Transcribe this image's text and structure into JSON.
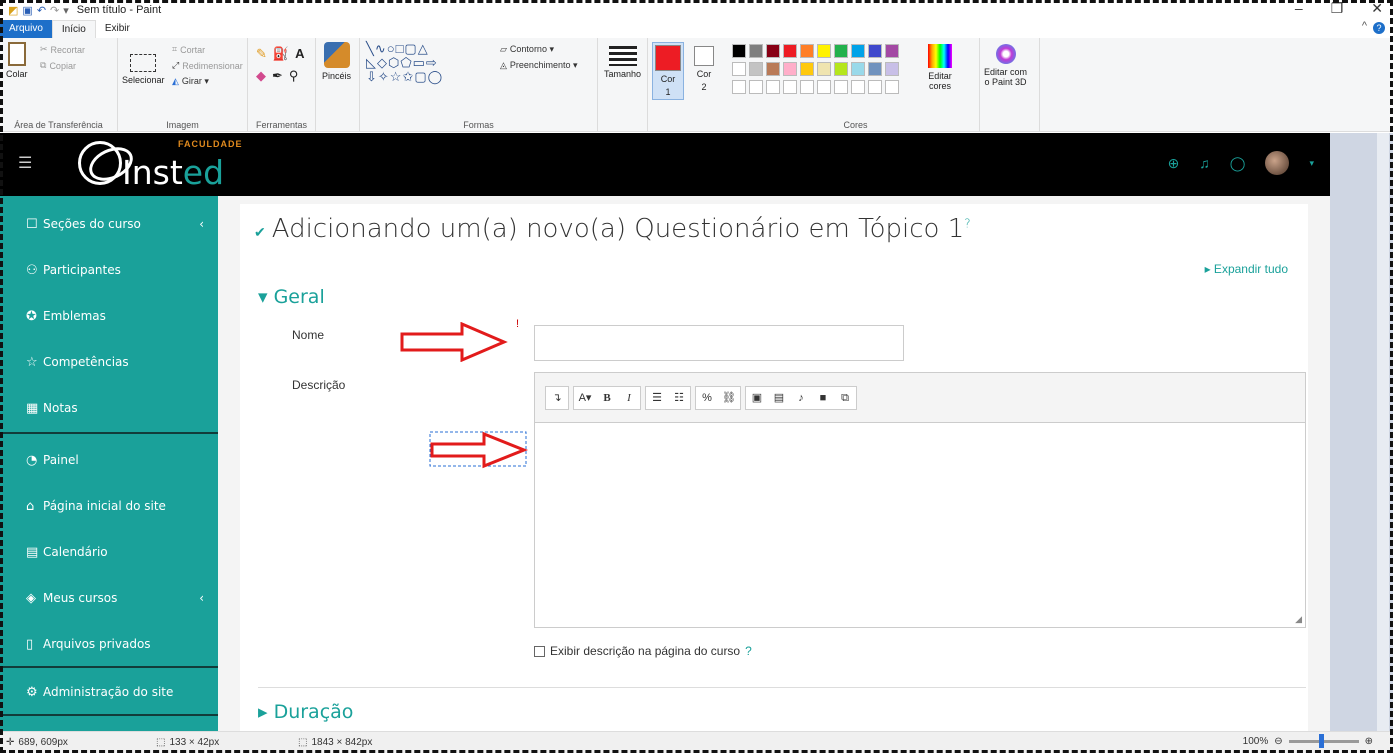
{
  "window": {
    "title": "Sem título - Paint",
    "minimize": "–",
    "maximize": "❐",
    "close": "✕"
  },
  "ribbon_tabs": [
    "Arquivo",
    "Início",
    "Exibir"
  ],
  "ribbon": {
    "clipboard": {
      "paste": "Colar",
      "cut": "Recortar",
      "copy": "Copiar",
      "label": "Área de Transferência"
    },
    "image": {
      "select": "Selecionar",
      "crop": "Cortar",
      "resize": "Redimensionar",
      "rotate": "Girar ▾",
      "label": "Imagem"
    },
    "tools": {
      "label": "Ferramentas"
    },
    "brushes": {
      "label": "Pincéis"
    },
    "shapes": {
      "outline": "Contorno ▾",
      "fill": "Preenchimento ▾",
      "label": "Formas"
    },
    "size": {
      "label": "Tamanho"
    },
    "color1": {
      "label1": "Cor",
      "label2": "1"
    },
    "color2": {
      "label1": "Cor",
      "label2": "2"
    },
    "colors": {
      "label": "Cores",
      "edit1": "Editar",
      "edit2": "cores"
    },
    "paint3d": {
      "label1": "Editar com",
      "label2": "o Paint 3D"
    },
    "palette_row1": [
      "#000000",
      "#7f7f7f",
      "#880015",
      "#ed1c24",
      "#ff7f27",
      "#fff200",
      "#22b14c",
      "#00a2e8",
      "#3f48cc",
      "#a349a4"
    ],
    "palette_row2": [
      "#ffffff",
      "#c3c3c3",
      "#b97a57",
      "#ffaec9",
      "#ffc90e",
      "#efe4b0",
      "#b5e61d",
      "#99d9ea",
      "#7092be",
      "#c8bfe7"
    ]
  },
  "header": {
    "logo_main": "Inst",
    "logo_accent": "ed",
    "logo_tag": "FACULDADE"
  },
  "sidebar": [
    {
      "icon": "☐",
      "label": "Seções do curso",
      "chevron": "‹"
    },
    {
      "icon": "⚇",
      "label": "Participantes"
    },
    {
      "icon": "✪",
      "label": "Emblemas"
    },
    {
      "icon": "☆",
      "label": "Competências"
    },
    {
      "icon": "▦",
      "label": "Notas"
    },
    {
      "icon": "◔",
      "label": "Painel"
    },
    {
      "icon": "⌂",
      "label": "Página inicial do site"
    },
    {
      "icon": "▤",
      "label": "Calendário"
    },
    {
      "icon": "◈",
      "label": "Meus cursos",
      "chevron": "‹"
    },
    {
      "icon": "▯",
      "label": "Arquivos privados"
    },
    {
      "icon": "⚙",
      "label": "Administração do site"
    }
  ],
  "main": {
    "title": "Adicionando um(a) novo(a) Questionário em Tópico 1",
    "help_mark": "?",
    "expand_all": "▸ Expandir tudo",
    "section_general": "▾ Geral",
    "name_label": "Nome",
    "required_mark": "!",
    "description_label": "Descrição",
    "editor_tools": [
      [
        "↴"
      ],
      [
        "A▾",
        "B",
        "I"
      ],
      [
        "☰",
        "☷"
      ],
      [
        "%",
        "⛓"
      ],
      [
        "▣",
        "▤",
        "♪",
        "■",
        "⧉"
      ]
    ],
    "show_description": "Exibir descrição na página do curso",
    "section_duration": "▸ Duração"
  },
  "status": {
    "coords": "689, 609px",
    "selection": "133 × 42px",
    "canvas": "1843 × 842px",
    "zoom": "100%"
  }
}
